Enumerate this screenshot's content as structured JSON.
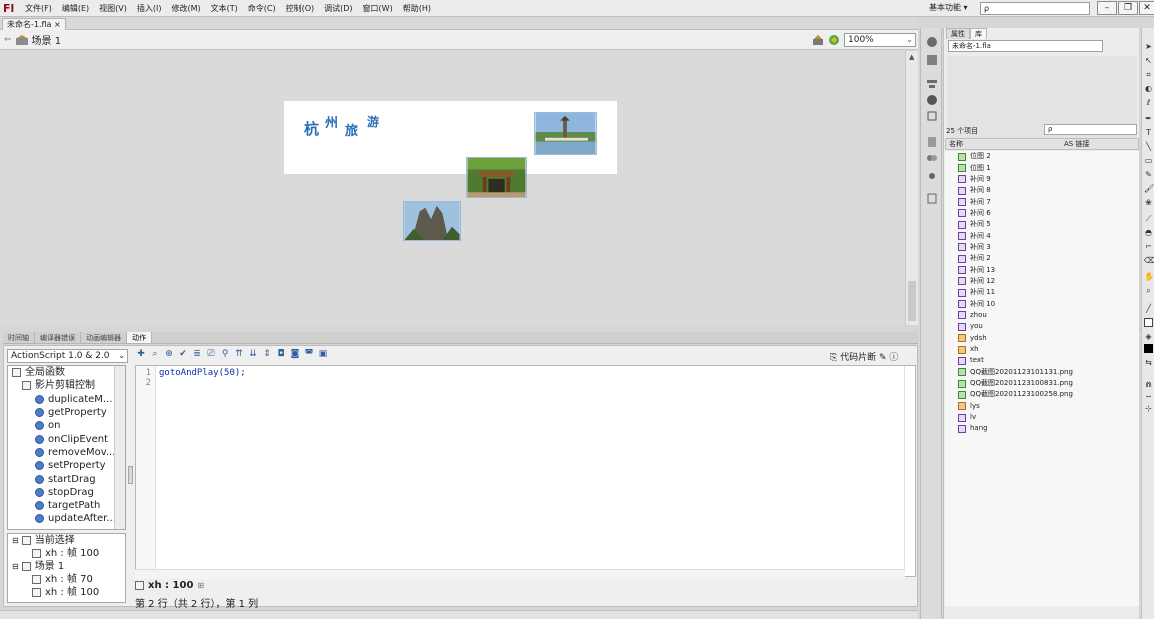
{
  "menubar": {
    "logo": "Fl",
    "items": [
      "文件(F)",
      "编辑(E)",
      "视图(V)",
      "插入(I)",
      "修改(M)",
      "文本(T)",
      "命令(C)",
      "控制(O)",
      "调试(D)",
      "窗口(W)",
      "帮助(H)"
    ],
    "workspace": "基本功能 ▾",
    "search_placeholder": "ρ"
  },
  "document": {
    "tab": "未命名-1.fla ×",
    "scene": "场景 1",
    "zoom": "100%"
  },
  "stage": {
    "title_chars": [
      "杭",
      "州",
      "旅",
      "游"
    ],
    "photos": [
      "pagoda-lake-photo",
      "gate-photo",
      "mountain-photo"
    ]
  },
  "panel_tabs": [
    "时间轴",
    "编译器错误",
    "动画编辑器",
    "动作"
  ],
  "actions": {
    "version_select": "ActionScript 1.0 & 2.0",
    "code_snippet": "代码片断",
    "tree": [
      {
        "label": "全局函数",
        "level": 0,
        "icon": "book"
      },
      {
        "label": "影片剪辑控制",
        "level": 1,
        "icon": "book"
      },
      {
        "label": "duplicateM...",
        "level": 2,
        "icon": "fn"
      },
      {
        "label": "getProperty",
        "level": 2,
        "icon": "fn"
      },
      {
        "label": "on",
        "level": 2,
        "icon": "fn"
      },
      {
        "label": "onClipEvent",
        "level": 2,
        "icon": "fn"
      },
      {
        "label": "removeMov...",
        "level": 2,
        "icon": "fn"
      },
      {
        "label": "setProperty",
        "level": 2,
        "icon": "fn"
      },
      {
        "label": "startDrag",
        "level": 2,
        "icon": "fn"
      },
      {
        "label": "stopDrag",
        "level": 2,
        "icon": "fn"
      },
      {
        "label": "targetPath",
        "level": 2,
        "icon": "fn"
      },
      {
        "label": "updateAfter...",
        "level": 2,
        "icon": "fn"
      }
    ],
    "tree2": [
      {
        "label": "当前选择",
        "level": 0
      },
      {
        "label": "xh : 帧 100",
        "level": 1
      },
      {
        "label": "场景 1",
        "level": 0
      },
      {
        "label": "xh : 帧 70",
        "level": 1
      },
      {
        "label": "xh : 帧 100",
        "level": 1
      }
    ],
    "line_numbers": [
      "1",
      "2"
    ],
    "code": "gotoAndPlay(50);",
    "script_tab": "xh : 100",
    "status": "第 2 行（共 2 行），第 1 列"
  },
  "library": {
    "tabs": [
      "属性",
      "库"
    ],
    "file": "未命名-1.fla",
    "count": "25 个项目",
    "search_placeholder": "ρ",
    "col_name": "名称",
    "col_linkage": "AS 链接",
    "items": [
      {
        "label": "位图 2",
        "type": "bmp"
      },
      {
        "label": "位图 1",
        "type": "bmp"
      },
      {
        "label": "补间 9",
        "type": "tw"
      },
      {
        "label": "补间 8",
        "type": "tw"
      },
      {
        "label": "补间 7",
        "type": "tw"
      },
      {
        "label": "补间 6",
        "type": "tw"
      },
      {
        "label": "补间 5",
        "type": "tw"
      },
      {
        "label": "补间 4",
        "type": "tw"
      },
      {
        "label": "补间 3",
        "type": "tw"
      },
      {
        "label": "补间 2",
        "type": "tw"
      },
      {
        "label": "补间 13",
        "type": "tw"
      },
      {
        "label": "补间 12",
        "type": "tw"
      },
      {
        "label": "补间 11",
        "type": "tw"
      },
      {
        "label": "补间 10",
        "type": "tw"
      },
      {
        "label": "zhou",
        "type": "tw"
      },
      {
        "label": "you",
        "type": "tw"
      },
      {
        "label": "ydsh",
        "type": "gr"
      },
      {
        "label": "xh",
        "type": "gr"
      },
      {
        "label": "text",
        "type": "tw"
      },
      {
        "label": "QQ截图20201123101131.png",
        "type": "bmp"
      },
      {
        "label": "QQ截图20201123100831.png",
        "type": "bmp"
      },
      {
        "label": "QQ截图20201123100258.png",
        "type": "bmp"
      },
      {
        "label": "lys",
        "type": "gr"
      },
      {
        "label": "lv",
        "type": "tw"
      },
      {
        "label": "hang",
        "type": "tw"
      }
    ]
  },
  "colors": {
    "title_blue": "#2a6db8",
    "code_blue": "#0a2fa8",
    "logo_red": "#8a0d12"
  }
}
